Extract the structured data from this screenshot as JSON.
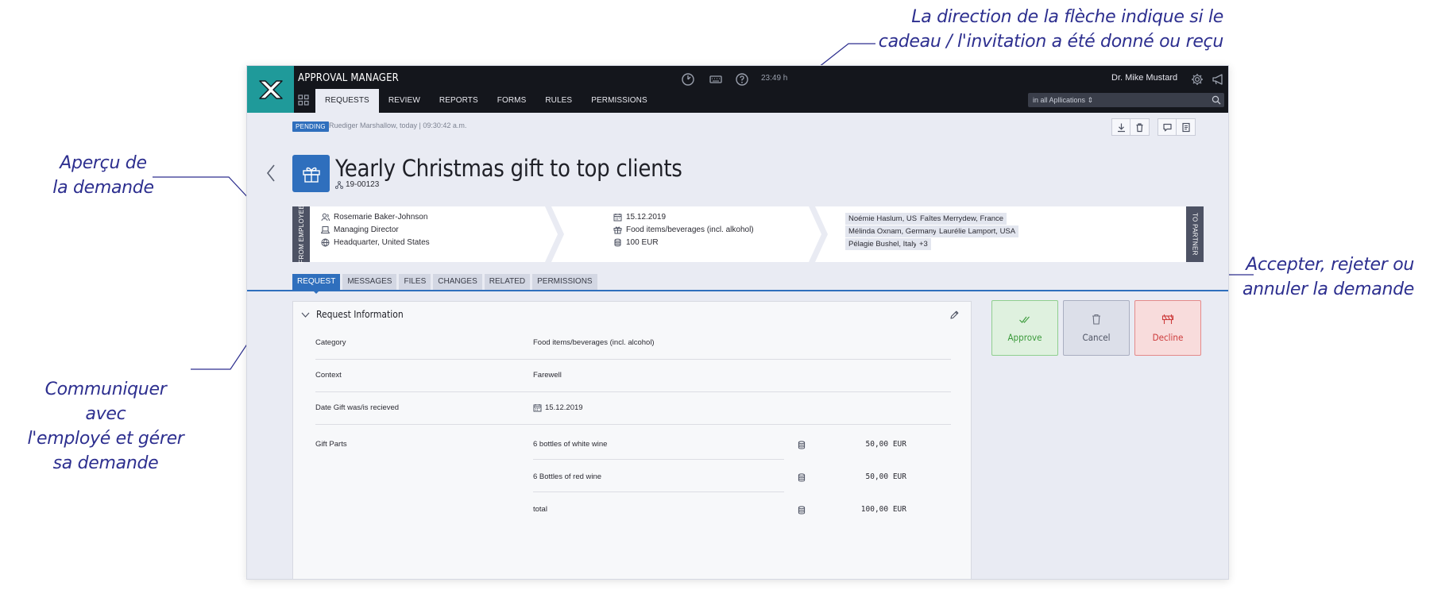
{
  "annotations": {
    "top": [
      "La direction de la flèche indique si le",
      "cadeau / l'invitation a été donné ou reçu"
    ],
    "preview": [
      "Aperçu de",
      "la demande"
    ],
    "communicate": [
      "Communiquer avec",
      "l'employé et gérer",
      "sa demande"
    ],
    "actions": [
      "Accepter, rejeter ou",
      "annuler la demande"
    ]
  },
  "header": {
    "app_title": "APPROVAL MANAGER",
    "nav": [
      "REQUESTS",
      "REVIEW",
      "REPORTS",
      "FORMS",
      "RULES",
      "PERMISSIONS"
    ],
    "active_nav": "REQUESTS",
    "time": "23:49 h",
    "user_name": "Dr. Mike Mustard",
    "search_placeholder": "in all Apllications ⇕"
  },
  "status": {
    "badge": "PENDING",
    "text": "Ruediger Marshallow, today | 09:30:42 a.m."
  },
  "request": {
    "title": "Yearly Christmas gift to top clients",
    "id": "19-00123"
  },
  "flow": {
    "from_label": "FROM EMPLOYEE",
    "to_label": "TO PARTNER",
    "employee": {
      "name": "Rosemarie Baker-Johnson",
      "role": "Managing Director",
      "location": "Headquarter, United States"
    },
    "gift": {
      "date": "15.12.2019",
      "category": "Food items/beverages (incl. alkohol)",
      "value": "100 EUR"
    },
    "partners": [
      "Noémie Haslum, USA",
      "Faîtes Merrydew, France",
      "Mélinda Oxnam, Germany",
      "Laurélie Lamport, USA",
      "Pélagie Bushel, Italy"
    ],
    "more": "+3"
  },
  "tabs": [
    "REQUEST",
    "MESSAGES",
    "FILES",
    "CHANGES",
    "RELATED",
    "PERMISSIONS"
  ],
  "active_tab": "REQUEST",
  "panel": {
    "title": "Request Information",
    "rows": {
      "category_label": "Category",
      "category_value": "Food items/beverages (incl. alcohol)",
      "context_label": "Context",
      "context_value": "Farewell",
      "date_label": "Date Gift was/is recieved",
      "date_value": "15.12.2019",
      "parts_label": "Gift Parts"
    },
    "parts": [
      {
        "name": "6 bottles of white wine",
        "amount": "50,00 EUR"
      },
      {
        "name": "6 Bottles of red wine",
        "amount": "50,00 EUR"
      },
      {
        "name": "total",
        "amount": "100,00 EUR"
      }
    ]
  },
  "actions": {
    "approve": "Approve",
    "cancel": "Cancel",
    "decline": "Decline"
  },
  "colors": {
    "accent": "#2f6fbd",
    "logo": "#1f9a9a",
    "topbar": "#14161c",
    "annotation": "#2d2f8f",
    "approve": "#3a9a3a",
    "decline": "#cd3b3b"
  }
}
